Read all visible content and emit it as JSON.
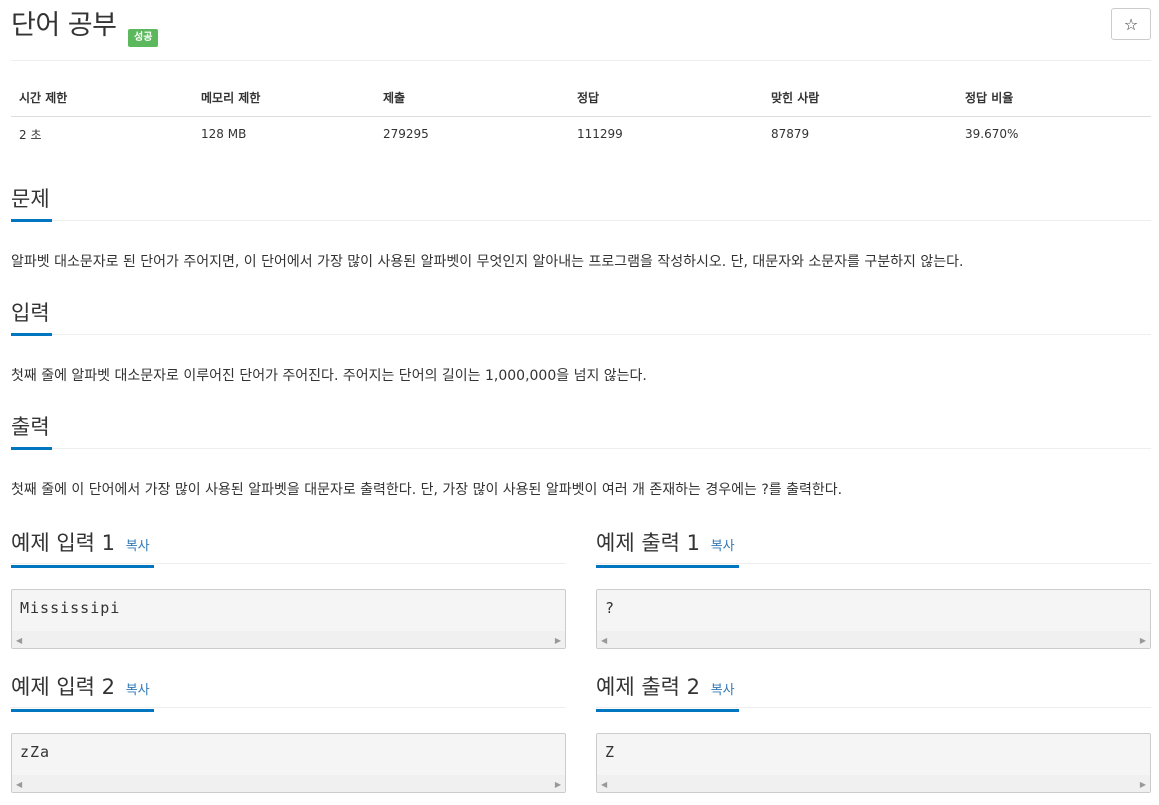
{
  "problem": {
    "title": "단어 공부",
    "badge": "성공",
    "star_icon": "☆"
  },
  "info_table": {
    "headers": [
      "시간 제한",
      "메모리 제한",
      "제출",
      "정답",
      "맞힌 사람",
      "정답 비율"
    ],
    "values": [
      "2 초",
      "128 MB",
      "279295",
      "111299",
      "87879",
      "39.670%"
    ]
  },
  "sections": {
    "problem": {
      "title": "문제",
      "text": "알파벳 대소문자로 된 단어가 주어지면, 이 단어에서 가장 많이 사용된 알파벳이 무엇인지 알아내는 프로그램을 작성하시오. 단, 대문자와 소문자를 구분하지 않는다."
    },
    "input": {
      "title": "입력",
      "text": "첫째 줄에 알파벳 대소문자로 이루어진 단어가 주어진다. 주어지는 단어의 길이는 1,000,000을 넘지 않는다."
    },
    "output": {
      "title": "출력",
      "text": "첫째 줄에 이 단어에서 가장 많이 사용된 알파벳을 대문자로 출력한다. 단, 가장 많이 사용된 알파벳이 여러 개 존재하는 경우에는 ?를 출력한다."
    }
  },
  "examples": {
    "copy_label": "복사",
    "in1": {
      "title": "예제 입력 1",
      "value": "Mississipi"
    },
    "out1": {
      "title": "예제 출력 1",
      "value": "?"
    },
    "in2": {
      "title": "예제 입력 2",
      "value": "zZa"
    },
    "out2": {
      "title": "예제 출력 2",
      "value": "Z"
    }
  },
  "colors": {
    "accent": "#0076c0",
    "badge": "#5cb85c",
    "link": "#337ab7"
  }
}
